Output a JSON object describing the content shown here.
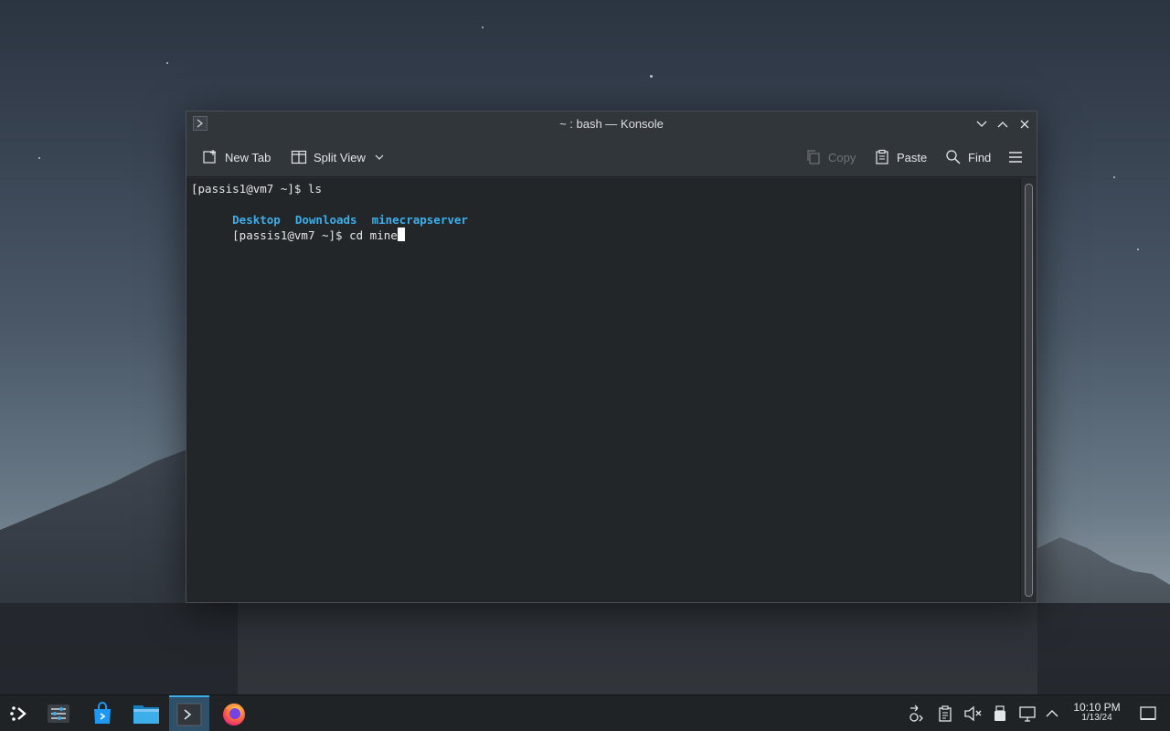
{
  "window": {
    "title": "~ : bash — Konsole",
    "toolbar": {
      "new_tab": "New Tab",
      "split_view": "Split View",
      "copy": "Copy",
      "paste": "Paste",
      "find": "Find"
    }
  },
  "terminal": {
    "line1": "[passis1@vm7 ~]$ ls",
    "dirs": [
      "Desktop",
      "Downloads",
      "minecrapserver"
    ],
    "line3_prompt": "[passis1@vm7 ~]$ cd mine"
  },
  "taskbar": {
    "apps": [
      "application-launcher",
      "system-settings",
      "discover-store",
      "dolphin-file-manager",
      "konsole",
      "firefox"
    ],
    "clock": {
      "time": "10:10 PM",
      "date": "1/13/24"
    }
  },
  "colors": {
    "accent": "#3daee9",
    "directory": "#3daee9",
    "terminal_bg": "#232629"
  }
}
